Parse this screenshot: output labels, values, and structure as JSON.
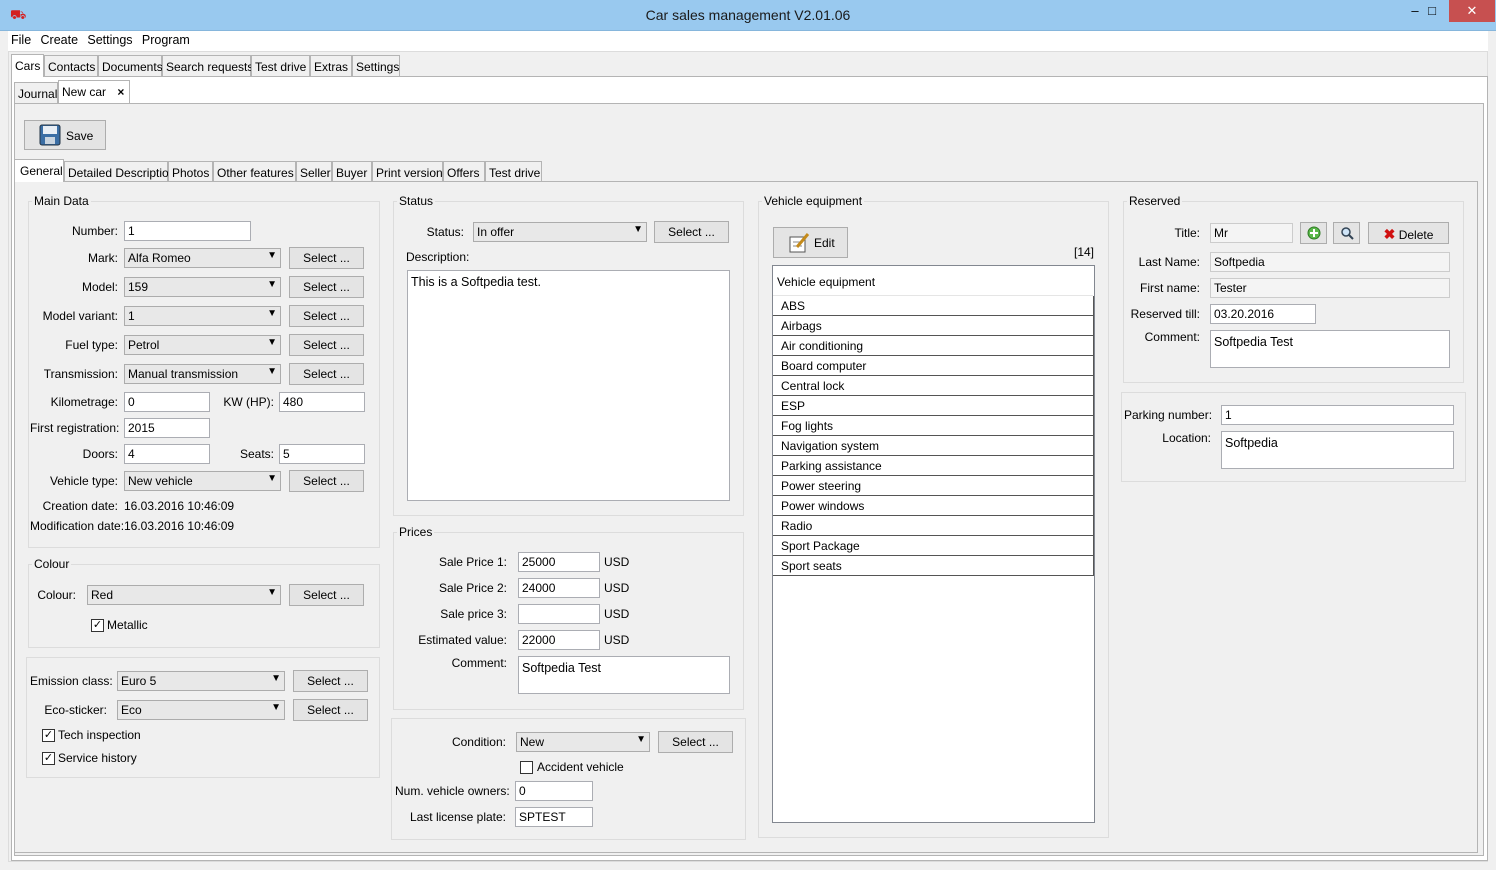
{
  "window": {
    "title": "Car sales management V2.01.06",
    "min": "–",
    "max": "□",
    "close": "✕",
    "app_icon": "car-icon"
  },
  "menu": [
    "File",
    "Create",
    "Settings",
    "Program"
  ],
  "main_tabs": [
    "Cars",
    "Contacts",
    "Documents",
    "Search requests",
    "Test drive",
    "Extras",
    "Settings"
  ],
  "sub_tabs": {
    "journal": "Journal",
    "new_car": "New car",
    "close": "×"
  },
  "toolbar": {
    "save": "Save"
  },
  "detail_tabs": [
    "General",
    "Detailed Description",
    "Photos",
    "Other features",
    "Seller",
    "Buyer",
    "Print version",
    "Offers",
    "Test drive"
  ],
  "select_label": "Select ...",
  "main_data": {
    "title": "Main Data",
    "number_label": "Number:",
    "number": "1",
    "mark_label": "Mark:",
    "mark": "Alfa Romeo",
    "model_label": "Model:",
    "model": "159",
    "variant_label": "Model variant:",
    "variant": "1",
    "fuel_label": "Fuel type:",
    "fuel": "Petrol",
    "trans_label": "Transmission:",
    "trans": "Manual transmission",
    "km_label": "Kilometrage:",
    "km": "0",
    "kw_label": "KW (HP):",
    "kw": "480",
    "firstreg_label": "First registration:",
    "firstreg": "2015",
    "doors_label": "Doors:",
    "doors": "4",
    "seats_label": "Seats:",
    "seats": "5",
    "vtype_label": "Vehicle type:",
    "vtype": "New vehicle",
    "created_label": "Creation date:",
    "created": "16.03.2016  10:46:09",
    "modified_label": "Modification date:",
    "modified": "16.03.2016  10:46:09"
  },
  "colour": {
    "title": "Colour",
    "colour_label": "Colour:",
    "colour": "Red",
    "metallic": "Metallic"
  },
  "emission": {
    "class_label": "Emission class:",
    "class": "Euro 5",
    "eco_label": "Eco-sticker:",
    "eco": "Eco",
    "tech": "Tech inspection",
    "service": "Service history"
  },
  "status": {
    "title": "Status",
    "status_label": "Status:",
    "status": "In offer",
    "desc_label": "Description:",
    "desc": "This is a Softpedia test."
  },
  "prices": {
    "title": "Prices",
    "sp1_label": "Sale Price 1:",
    "sp1": "25000",
    "sp2_label": "Sale Price 2:",
    "sp2": "24000",
    "sp3_label": "Sale price 3:",
    "sp3": "",
    "est_label": "Estimated value:",
    "est": "22000",
    "currency": "USD",
    "comment_label": "Comment:",
    "comment": "Softpedia Test"
  },
  "condition": {
    "condition_label": "Condition:",
    "condition": "New",
    "accident": "Accident vehicle",
    "owners_label": "Num. vehicle owners:",
    "owners": "0",
    "plate_label": "Last license plate:",
    "plate": "SPTEST"
  },
  "equipment": {
    "title": "Vehicle equipment",
    "edit": "Edit",
    "count": "[14]",
    "header": "Vehicle equipment",
    "items": [
      "ABS",
      "Airbags",
      "Air conditioning",
      "Board computer",
      "Central lock",
      "ESP",
      "Fog lights",
      "Navigation system",
      "Parking assistance",
      "Power steering",
      "Power windows",
      "Radio",
      "Sport Package",
      "Sport seats"
    ]
  },
  "reserved": {
    "title": "Reserved",
    "title_label": "Title:",
    "title_value": "Mr",
    "delete": "Delete",
    "last_label": "Last Name:",
    "last": "Softpedia",
    "first_label": "First name:",
    "first": "Tester",
    "till_label": "Reserved till:",
    "till": "03.20.2016",
    "comment_label": "Comment:",
    "comment": "Softpedia Test"
  },
  "parking": {
    "num_label": "Parking number:",
    "num": "1",
    "loc_label": "Location:",
    "loc": "Softpedia"
  }
}
